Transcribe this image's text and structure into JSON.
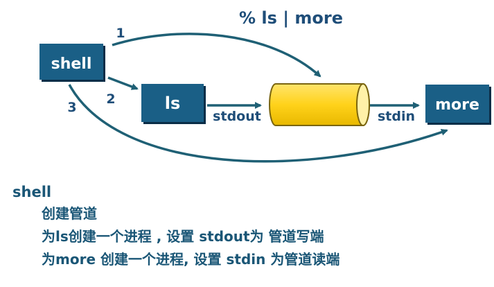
{
  "colors": {
    "box_fill": "#1a5f86",
    "box_shadow": "#0a2d47",
    "arrow": "#1f6075",
    "label": "#1f4e79",
    "pipe_fill": "#ffd21a",
    "pipe_stroke": "#7a6510",
    "text": "#1a5676"
  },
  "diagram": {
    "command": "% ls | more",
    "shell_box": "shell",
    "ls_box": "ls",
    "more_box": "more",
    "arrow_labels": [
      "1",
      "2",
      "3"
    ],
    "stdout_label": "stdout",
    "stdin_label": "stdin"
  },
  "description": {
    "heading": "shell",
    "lines": [
      "创建管道",
      "为ls创建一个进程 , 设置 stdout为 管道写端",
      "为more 创建一个进程, 设置 stdin 为管道读端"
    ]
  }
}
